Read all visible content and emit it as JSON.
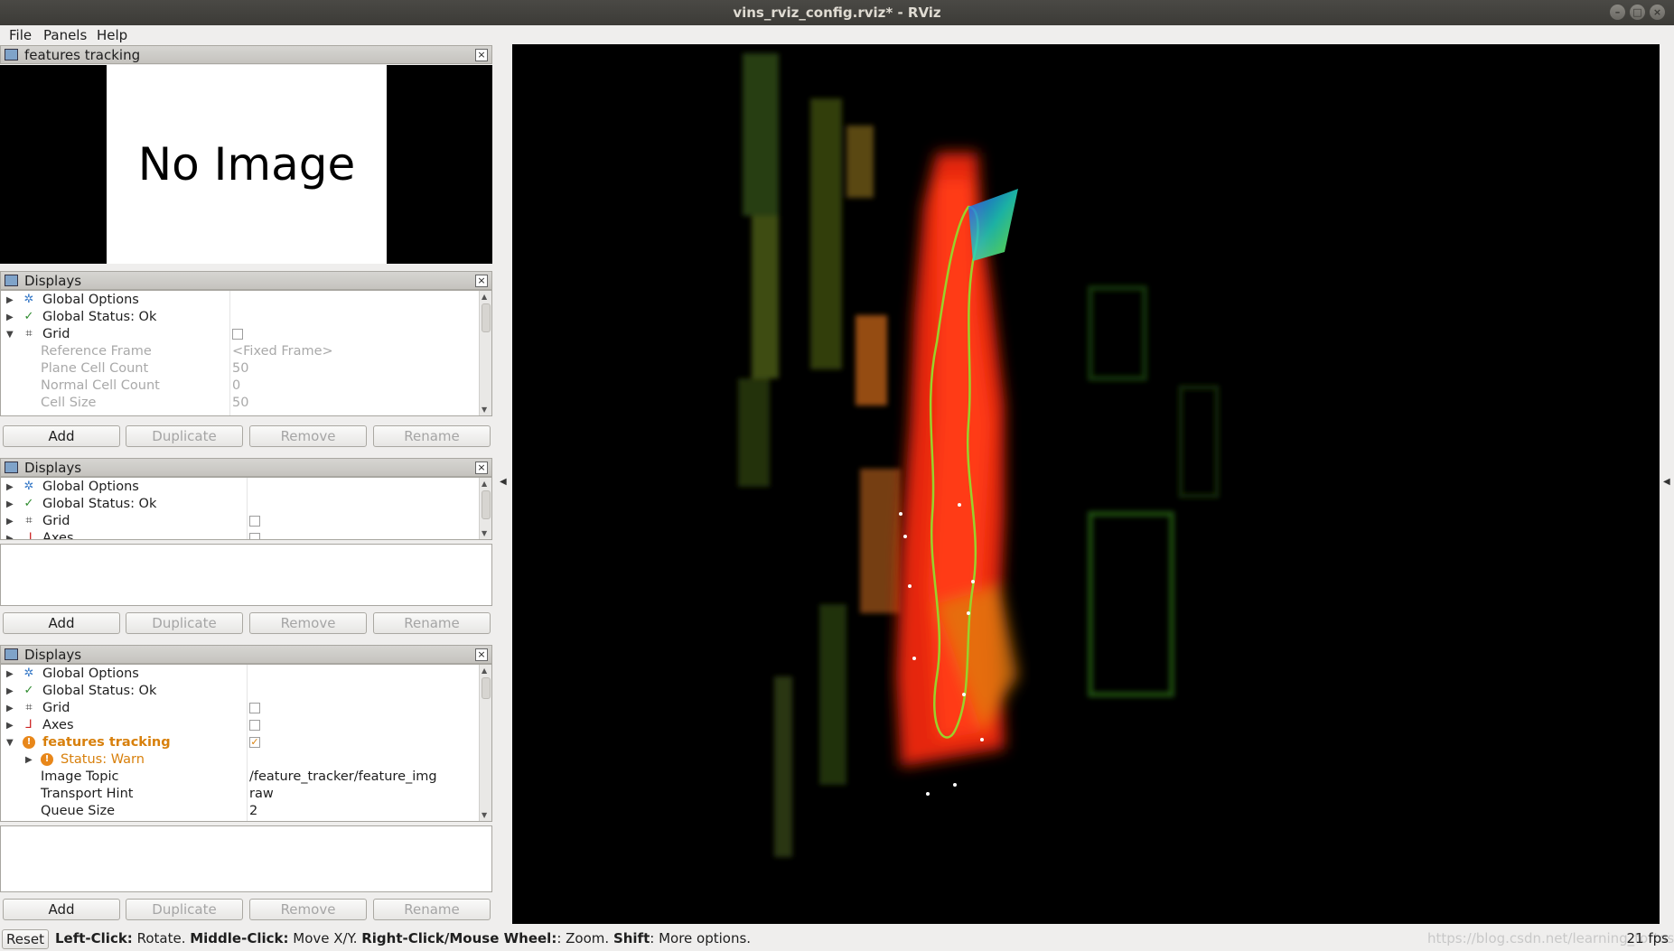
{
  "window": {
    "title": "vins_rviz_config.rviz* - RViz"
  },
  "menu": {
    "file": "File",
    "panels": "Panels",
    "help": "Help"
  },
  "image_panel": {
    "title": "features tracking",
    "placeholder": "No Image"
  },
  "displays1": {
    "title": "Displays",
    "rows": {
      "global_options": "Global Options",
      "global_status": "Global Status: Ok",
      "grid": "Grid",
      "reference_frame": "Reference Frame",
      "reference_frame_value": "<Fixed Frame>",
      "plane_cell_count": "Plane Cell Count",
      "plane_cell_count_value": "50",
      "normal_cell_count": "Normal Cell Count",
      "normal_cell_count_value": "0",
      "cell_size": "Cell Size",
      "cell_size_value": "50"
    }
  },
  "displays2": {
    "title": "Displays",
    "rows": {
      "global_options": "Global Options",
      "global_status": "Global Status: Ok",
      "grid": "Grid",
      "axes": "Axes"
    }
  },
  "displays3": {
    "title": "Displays",
    "rows": {
      "global_options": "Global Options",
      "global_status": "Global Status: Ok",
      "grid": "Grid",
      "axes": "Axes",
      "features_tracking": "features tracking",
      "status_warn": "Status: Warn",
      "image_topic": "Image Topic",
      "image_topic_value": "/feature_tracker/feature_img",
      "transport_hint": "Transport Hint",
      "transport_hint_value": "raw",
      "queue_size": "Queue Size",
      "queue_size_value": "2"
    }
  },
  "buttons": {
    "add": "Add",
    "duplicate": "Duplicate",
    "remove": "Remove",
    "rename": "Rename"
  },
  "statusbar": {
    "reset": "Reset",
    "left_click_key": "Left-Click:",
    "left_click_val": " Rotate. ",
    "middle_click_key": "Middle-Click:",
    "middle_click_val": " Move X/Y. ",
    "right_click_key": "Right-Click/Mouse Wheel:",
    "right_click_val": ": Zoom. ",
    "shift_key": "Shift",
    "shift_val": ": More options.",
    "watermark": "https://blog.csdn.net/learning_tortosie",
    "fps": "21 fps"
  },
  "colors": {
    "warn": "#d8800c",
    "ok": "#2e8b2e",
    "viewer_bg": "#000000"
  }
}
